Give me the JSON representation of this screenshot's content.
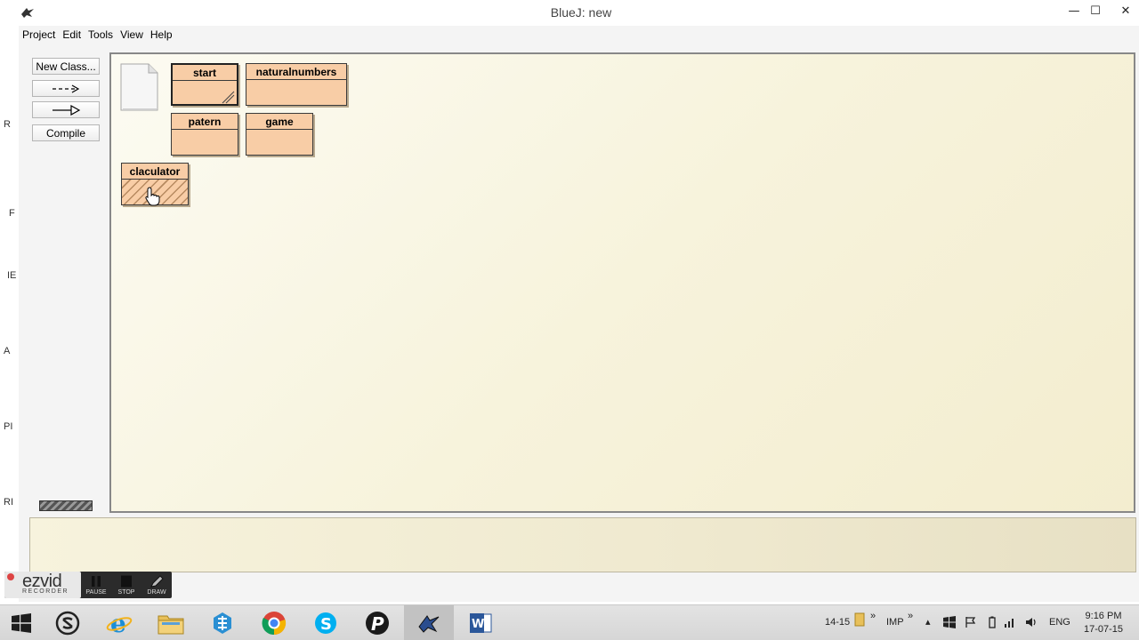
{
  "window": {
    "title": "BlueJ:  new"
  },
  "menu": [
    "Project",
    "Edit",
    "Tools",
    "View",
    "Help"
  ],
  "left_rim_letters": [
    "R",
    "F",
    "IE",
    "A",
    "PI",
    "RI"
  ],
  "toolbar": {
    "new_class_label": "New Class...",
    "uses_arrow_label": "--->",
    "inherit_arrow_label": "—▷",
    "compile_label": "Compile"
  },
  "classes": [
    {
      "name": "start",
      "state": "compiled-selected"
    },
    {
      "name": "naturalnumbers",
      "state": "compiled"
    },
    {
      "name": "patern",
      "state": "compiled"
    },
    {
      "name": "game",
      "state": "compiled"
    },
    {
      "name": "claculator",
      "state": "uncompiled"
    }
  ],
  "recorder": {
    "logo_main": "ezvid",
    "logo_sub": "RECORDER",
    "buttons": [
      "PAUSE",
      "STOP",
      "DRAW"
    ]
  },
  "taskbar": {
    "tray_label": "14-15",
    "tray_imp": "IMP",
    "language": "ENG",
    "time": "9:16 PM",
    "date": "17-07-15"
  },
  "colors": {
    "class_fill": "#f8cda6",
    "canvas_bg": "#f7f3dc",
    "taskbar_bg": "#d6d6d6"
  }
}
